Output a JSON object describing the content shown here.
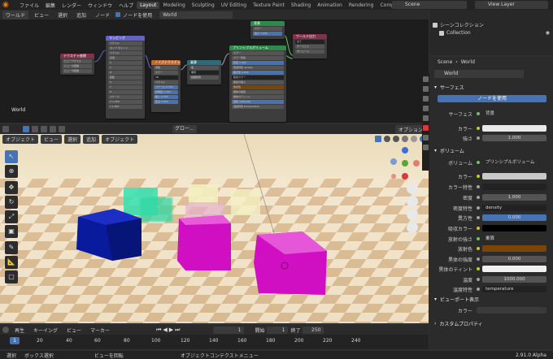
{
  "topbar": {
    "menu": [
      "ファイル",
      "編集",
      "レンダー",
      "ウィンドウ",
      "ヘルプ"
    ],
    "workspaces": [
      "Layout",
      "Modeling",
      "Sculpting",
      "UV Editing",
      "Texture Paint",
      "Shading",
      "Animation",
      "Rendering",
      "Compositing"
    ],
    "scene": "Scene",
    "view_layer": "View Layer"
  },
  "node_editor": {
    "world_dropdown": "ワールド",
    "menus": [
      "ビュー",
      "選択",
      "追加",
      "ノード"
    ],
    "use_nodes": "ノードを使用",
    "world_name": "World",
    "corner_label": "World",
    "nodes": {
      "texcoord": {
        "title": "テクスチャ座標",
        "rows": [
          "ビューベクトル",
          "ビューの距離",
          "ビューの距離"
        ]
      },
      "mapping": {
        "title": "マッピング",
        "rows": [
          "ベクトル",
          "タイプ ポイント",
          "ベクトル",
          "位置",
          "X",
          "Y",
          "Z",
          "回転",
          "X",
          "Y",
          "Z",
          "スケール",
          "X 1.000",
          "Y 1.000"
        ]
      },
      "noise": {
        "title": "ノイズテクスチャ",
        "rows": [
          "係数",
          "カラー",
          "3D",
          "ベクトル",
          "スケール 5.700",
          "詳細度 2.000",
          "粗さ 0.500",
          "歪み 0.000"
        ]
      },
      "ramp": {
        "title": "乗算",
        "rows": [
          "値",
          "乗算",
          "範囲制限"
        ]
      },
      "bg": {
        "title": "背景",
        "rows": [
          "カラー",
          "強さ 1.000"
        ]
      },
      "principled": {
        "title": "プリンシプルボリューム",
        "rows": [
          "カラー",
          "カラー特性",
          "密度 1.000",
          "密度特性 density",
          "異方性 0.000",
          "吸収カラー",
          "放射の強さ",
          "放射色",
          "黒体の強度",
          "黒体のティント",
          "温度 1000.000",
          "温度特性 temperature"
        ]
      },
      "output": {
        "title": "ワールド出力",
        "rows": [
          "全て",
          "サーフェス",
          "ボリューム"
        ]
      }
    }
  },
  "viewport": {
    "mode": "オブジェクト",
    "menus": [
      "ビュー",
      "選択",
      "追加",
      "オブジェクト"
    ],
    "transform": "グロー...",
    "options": "オプション"
  },
  "outliner": {
    "scene_collection": "シーンコレクション",
    "collection": "Collection"
  },
  "properties": {
    "breadcrumb_scene": "Scene",
    "breadcrumb_world": "World",
    "world_name": "World",
    "surface_header": "サーフェス",
    "use_nodes_btn": "ノードを使用",
    "surface": [
      {
        "label": "サーフェス",
        "value": "背景"
      },
      {
        "label": "カラー",
        "value": ""
      },
      {
        "label": "強さ",
        "value": "1.000"
      }
    ],
    "volume_header": "ボリューム",
    "volume": [
      {
        "label": "ボリューム",
        "value": "プリンシプルボリューム"
      },
      {
        "label": "カラー",
        "value": ""
      },
      {
        "label": "カラー特性",
        "value": ""
      },
      {
        "label": "密度",
        "value": "1.000"
      },
      {
        "label": "密度特性",
        "value": "density"
      },
      {
        "label": "異方性",
        "value": "0.000"
      },
      {
        "label": "吸収カラー",
        "value": ""
      },
      {
        "label": "放射の強さ",
        "value": "乗算"
      },
      {
        "label": "放射色",
        "value": ""
      },
      {
        "label": "黒体の強度",
        "value": "0.000"
      },
      {
        "label": "黒体のティント",
        "value": ""
      },
      {
        "label": "温度",
        "value": "1000.000"
      },
      {
        "label": "温度特性",
        "value": "temperature"
      }
    ],
    "viewport_display_header": "ビューポート表示",
    "viewport_color_label": "カラー",
    "custom_props_header": "カスタムプロパティ"
  },
  "timeline": {
    "menus": [
      "再生",
      "キーイング",
      "ビュー",
      "マーカー"
    ],
    "current_frame": "1",
    "start_label": "開始",
    "start_value": "1",
    "end_label": "終了",
    "end_value": "250",
    "ticks": [
      "1",
      "20",
      "40",
      "60",
      "80",
      "100",
      "120",
      "140",
      "160",
      "180",
      "200",
      "220",
      "240"
    ]
  },
  "statusbar": {
    "items": [
      "選択",
      "ボックス選択",
      "ビューを回転",
      "オブジェクトコンテクストメニュー"
    ],
    "version": "2.91.0 Alpha"
  },
  "colors": {
    "accent": "#4772b3",
    "cube_blue": "#0a1a9c",
    "cube_magenta": "#d10fc2",
    "cube_teal": "#32e0b0",
    "cube_yellow": "#f3f0c0"
  }
}
